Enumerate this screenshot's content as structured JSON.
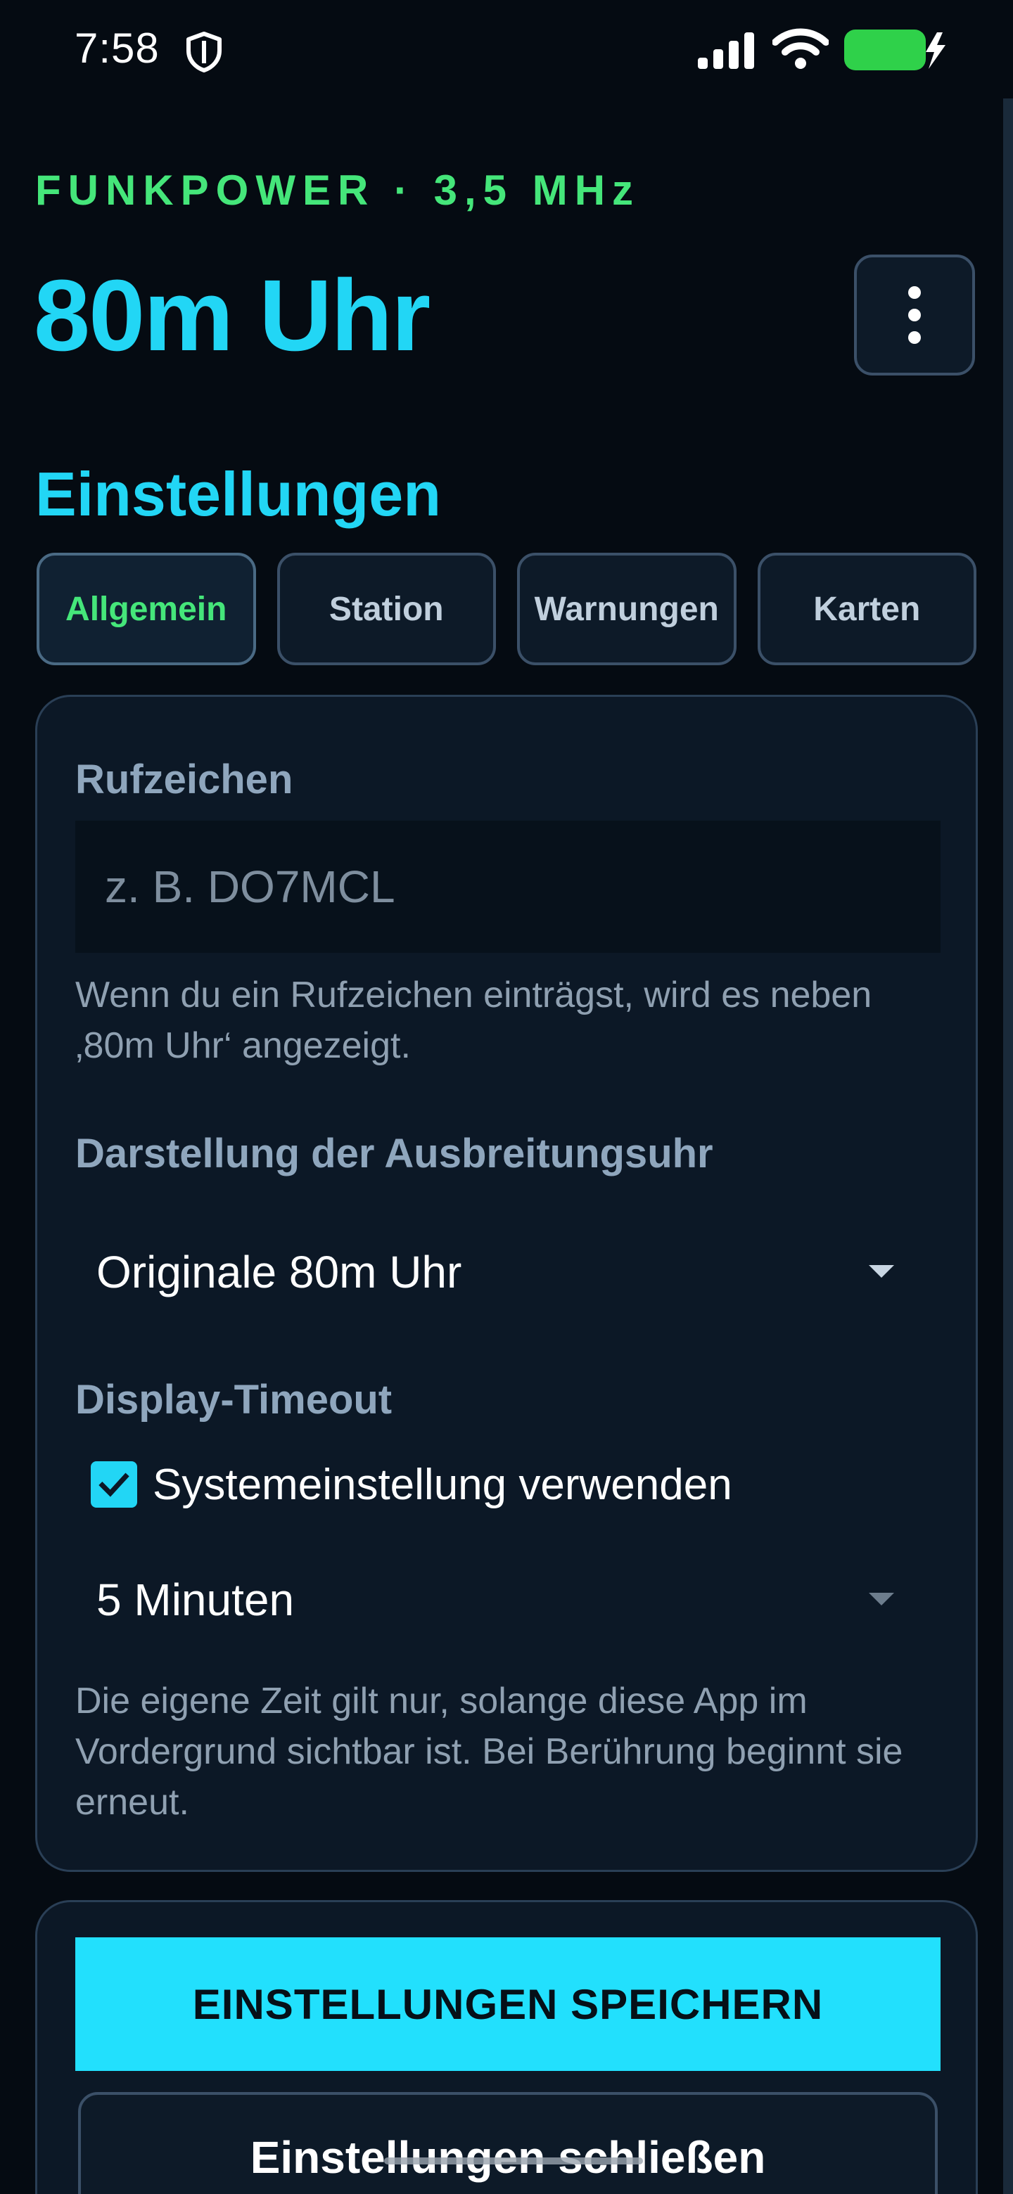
{
  "status_bar": {
    "time": "7:58",
    "icons": [
      "shield-icon",
      "signal-icon",
      "wifi-icon",
      "battery-charging-icon"
    ],
    "battery_color": "#2fd14a"
  },
  "header": {
    "brand": "FUNKPOWER · 3,5 MHz",
    "title": "80m Uhr",
    "menu_icon": "more-vertical-icon"
  },
  "settings": {
    "title": "Einstellungen",
    "tabs": [
      {
        "label": "Allgemein",
        "active": true
      },
      {
        "label": "Station",
        "active": false
      },
      {
        "label": "Warnungen",
        "active": false
      },
      {
        "label": "Karten",
        "active": false
      }
    ],
    "callsign": {
      "label": "Rufzeichen",
      "value": "",
      "placeholder": "z. B. DO7MCL",
      "help": "Wenn du ein Rufzeichen einträgst, wird es neben ‚80m Uhr‘ angezeigt."
    },
    "clock_display": {
      "label": "Darstellung der Ausbreitungsuhr",
      "selected": "Originale 80m Uhr"
    },
    "display_timeout": {
      "label": "Display-Timeout",
      "use_system_label": "Systemeinstellung verwenden",
      "use_system_checked": true,
      "selected": "5 Minuten",
      "help": "Die eigene Zeit gilt nur, solange diese App im Vordergrund sichtbar ist. Bei Berührung beginnt sie erneut."
    }
  },
  "actions": {
    "save_label": "EINSTELLUNGEN SPEICHERN",
    "close_label": "Einstellungen schließen"
  },
  "colors": {
    "accent_cyan": "#22d6f5",
    "accent_green": "#45e67a",
    "background": "#050b12",
    "card": "#0c1826"
  }
}
